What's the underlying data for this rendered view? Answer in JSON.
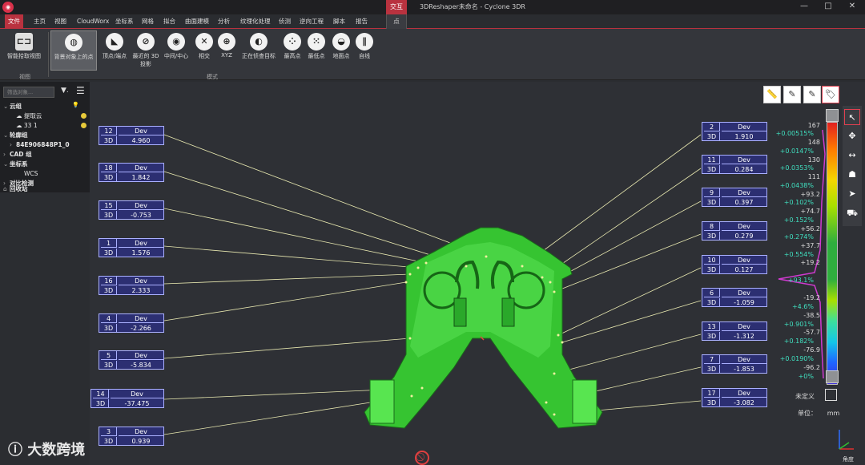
{
  "titlebar": {
    "context_tab": "交互",
    "title": "3DReshaper未命名 - Cyclone 3DR",
    "minimize": "—",
    "maximize": "□",
    "close": "✕"
  },
  "menu": {
    "file": "文件",
    "items": [
      "主页",
      "视图",
      "CloudWorx",
      "坐标系",
      "网格",
      "拟合",
      "曲面建模",
      "分析",
      "纹理化处理",
      "侦测",
      "逆向工程",
      "脚本",
      "报告"
    ],
    "context": "点"
  },
  "ribbon": {
    "buttons": [
      {
        "label": "智能拾取视图",
        "icon": "smart-pick-view-icon"
      },
      {
        "label": "背景对象上的点",
        "icon": "point-on-object-icon"
      },
      {
        "label": "顶点/端点",
        "icon": "vertex-icon"
      },
      {
        "label": "最近的 3D 投影",
        "icon": "nearest-projection-icon"
      },
      {
        "label": "中间/中心",
        "icon": "center-icon"
      },
      {
        "label": "相交",
        "icon": "intersection-icon"
      },
      {
        "label": "XYZ",
        "icon": "xyz-icon"
      },
      {
        "label": "正在侦查目标",
        "icon": "target-icon"
      },
      {
        "label": "最高点",
        "icon": "highest-point-icon"
      },
      {
        "label": "最低点",
        "icon": "lowest-point-icon"
      },
      {
        "label": "地面点",
        "icon": "ground-point-icon"
      },
      {
        "label": "自线",
        "icon": "line-icon"
      }
    ],
    "groups": [
      "视图",
      "模式"
    ]
  },
  "tree": {
    "search_placeholder": "筛选对象...",
    "nodes": [
      {
        "label": "云组",
        "bold": true
      },
      {
        "label": "提取云"
      },
      {
        "label": "33 1"
      },
      {
        "label": "轮廓组",
        "bold": true
      },
      {
        "label": "84E906848P1_0",
        "bold": true
      },
      {
        "label": "CAD 组",
        "bold": true
      },
      {
        "label": "坐标系",
        "bold": true
      },
      {
        "label": "WCS"
      },
      {
        "label": "对比检测",
        "bold": true
      },
      {
        "label": "回收站",
        "bold": true
      }
    ]
  },
  "labels_left": [
    {
      "id": "12",
      "header": "Dev",
      "mode": "3D",
      "value": "4.960"
    },
    {
      "id": "18",
      "header": "Dev",
      "mode": "3D",
      "value": "1.842"
    },
    {
      "id": "15",
      "header": "Dev",
      "mode": "3D",
      "value": "-0.753"
    },
    {
      "id": "1",
      "header": "Dev",
      "mode": "3D",
      "value": "1.576"
    },
    {
      "id": "16",
      "header": "Dev",
      "mode": "3D",
      "value": "2.333"
    },
    {
      "id": "4",
      "header": "Dev",
      "mode": "3D",
      "value": "-2.266"
    },
    {
      "id": "5",
      "header": "Dev",
      "mode": "3D",
      "value": "-5.834"
    },
    {
      "id": "14",
      "header": "Dev",
      "mode": "3D",
      "value": "-37.475"
    },
    {
      "id": "3",
      "header": "Dev",
      "mode": "3D",
      "value": "0.939"
    }
  ],
  "labels_right": [
    {
      "id": "2",
      "header": "Dev",
      "mode": "3D",
      "value": "1.910"
    },
    {
      "id": "11",
      "header": "Dev",
      "mode": "3D",
      "value": "0.284"
    },
    {
      "id": "9",
      "header": "Dev",
      "mode": "3D",
      "value": "0.397"
    },
    {
      "id": "8",
      "header": "Dev",
      "mode": "3D",
      "value": "0.279"
    },
    {
      "id": "10",
      "header": "Dev",
      "mode": "3D",
      "value": "0.127"
    },
    {
      "id": "6",
      "header": "Dev",
      "mode": "3D",
      "value": "-1.059"
    },
    {
      "id": "13",
      "header": "Dev",
      "mode": "3D",
      "value": "-1.312"
    },
    {
      "id": "7",
      "header": "Dev",
      "mode": "3D",
      "value": "-1.853"
    },
    {
      "id": "17",
      "header": "Dev",
      "mode": "3D",
      "value": "-3.082"
    }
  ],
  "scale": {
    "ticks": [
      "167",
      "148",
      "130",
      "111",
      "+93.2",
      "+74.7",
      "+56.2",
      "+37.7",
      "+19.2",
      "-19.2",
      "-38.5",
      "-57.7",
      "-76.9",
      "-96.2"
    ],
    "percents": [
      "+0.00515%",
      "+0.0147%",
      "+0.0353%",
      "+0.0438%",
      "+0.102%",
      "+0.152%",
      "+0.274%",
      "+0.554%",
      "+93.1%",
      "+4.6%",
      "+0.901%",
      "+0.182%",
      "+0.0190%",
      "+0%"
    ],
    "undefined_label": "未定义",
    "unit_label": "单位：",
    "unit_value": "mm"
  },
  "angle_label": "角度",
  "watermark": "大数跨境"
}
